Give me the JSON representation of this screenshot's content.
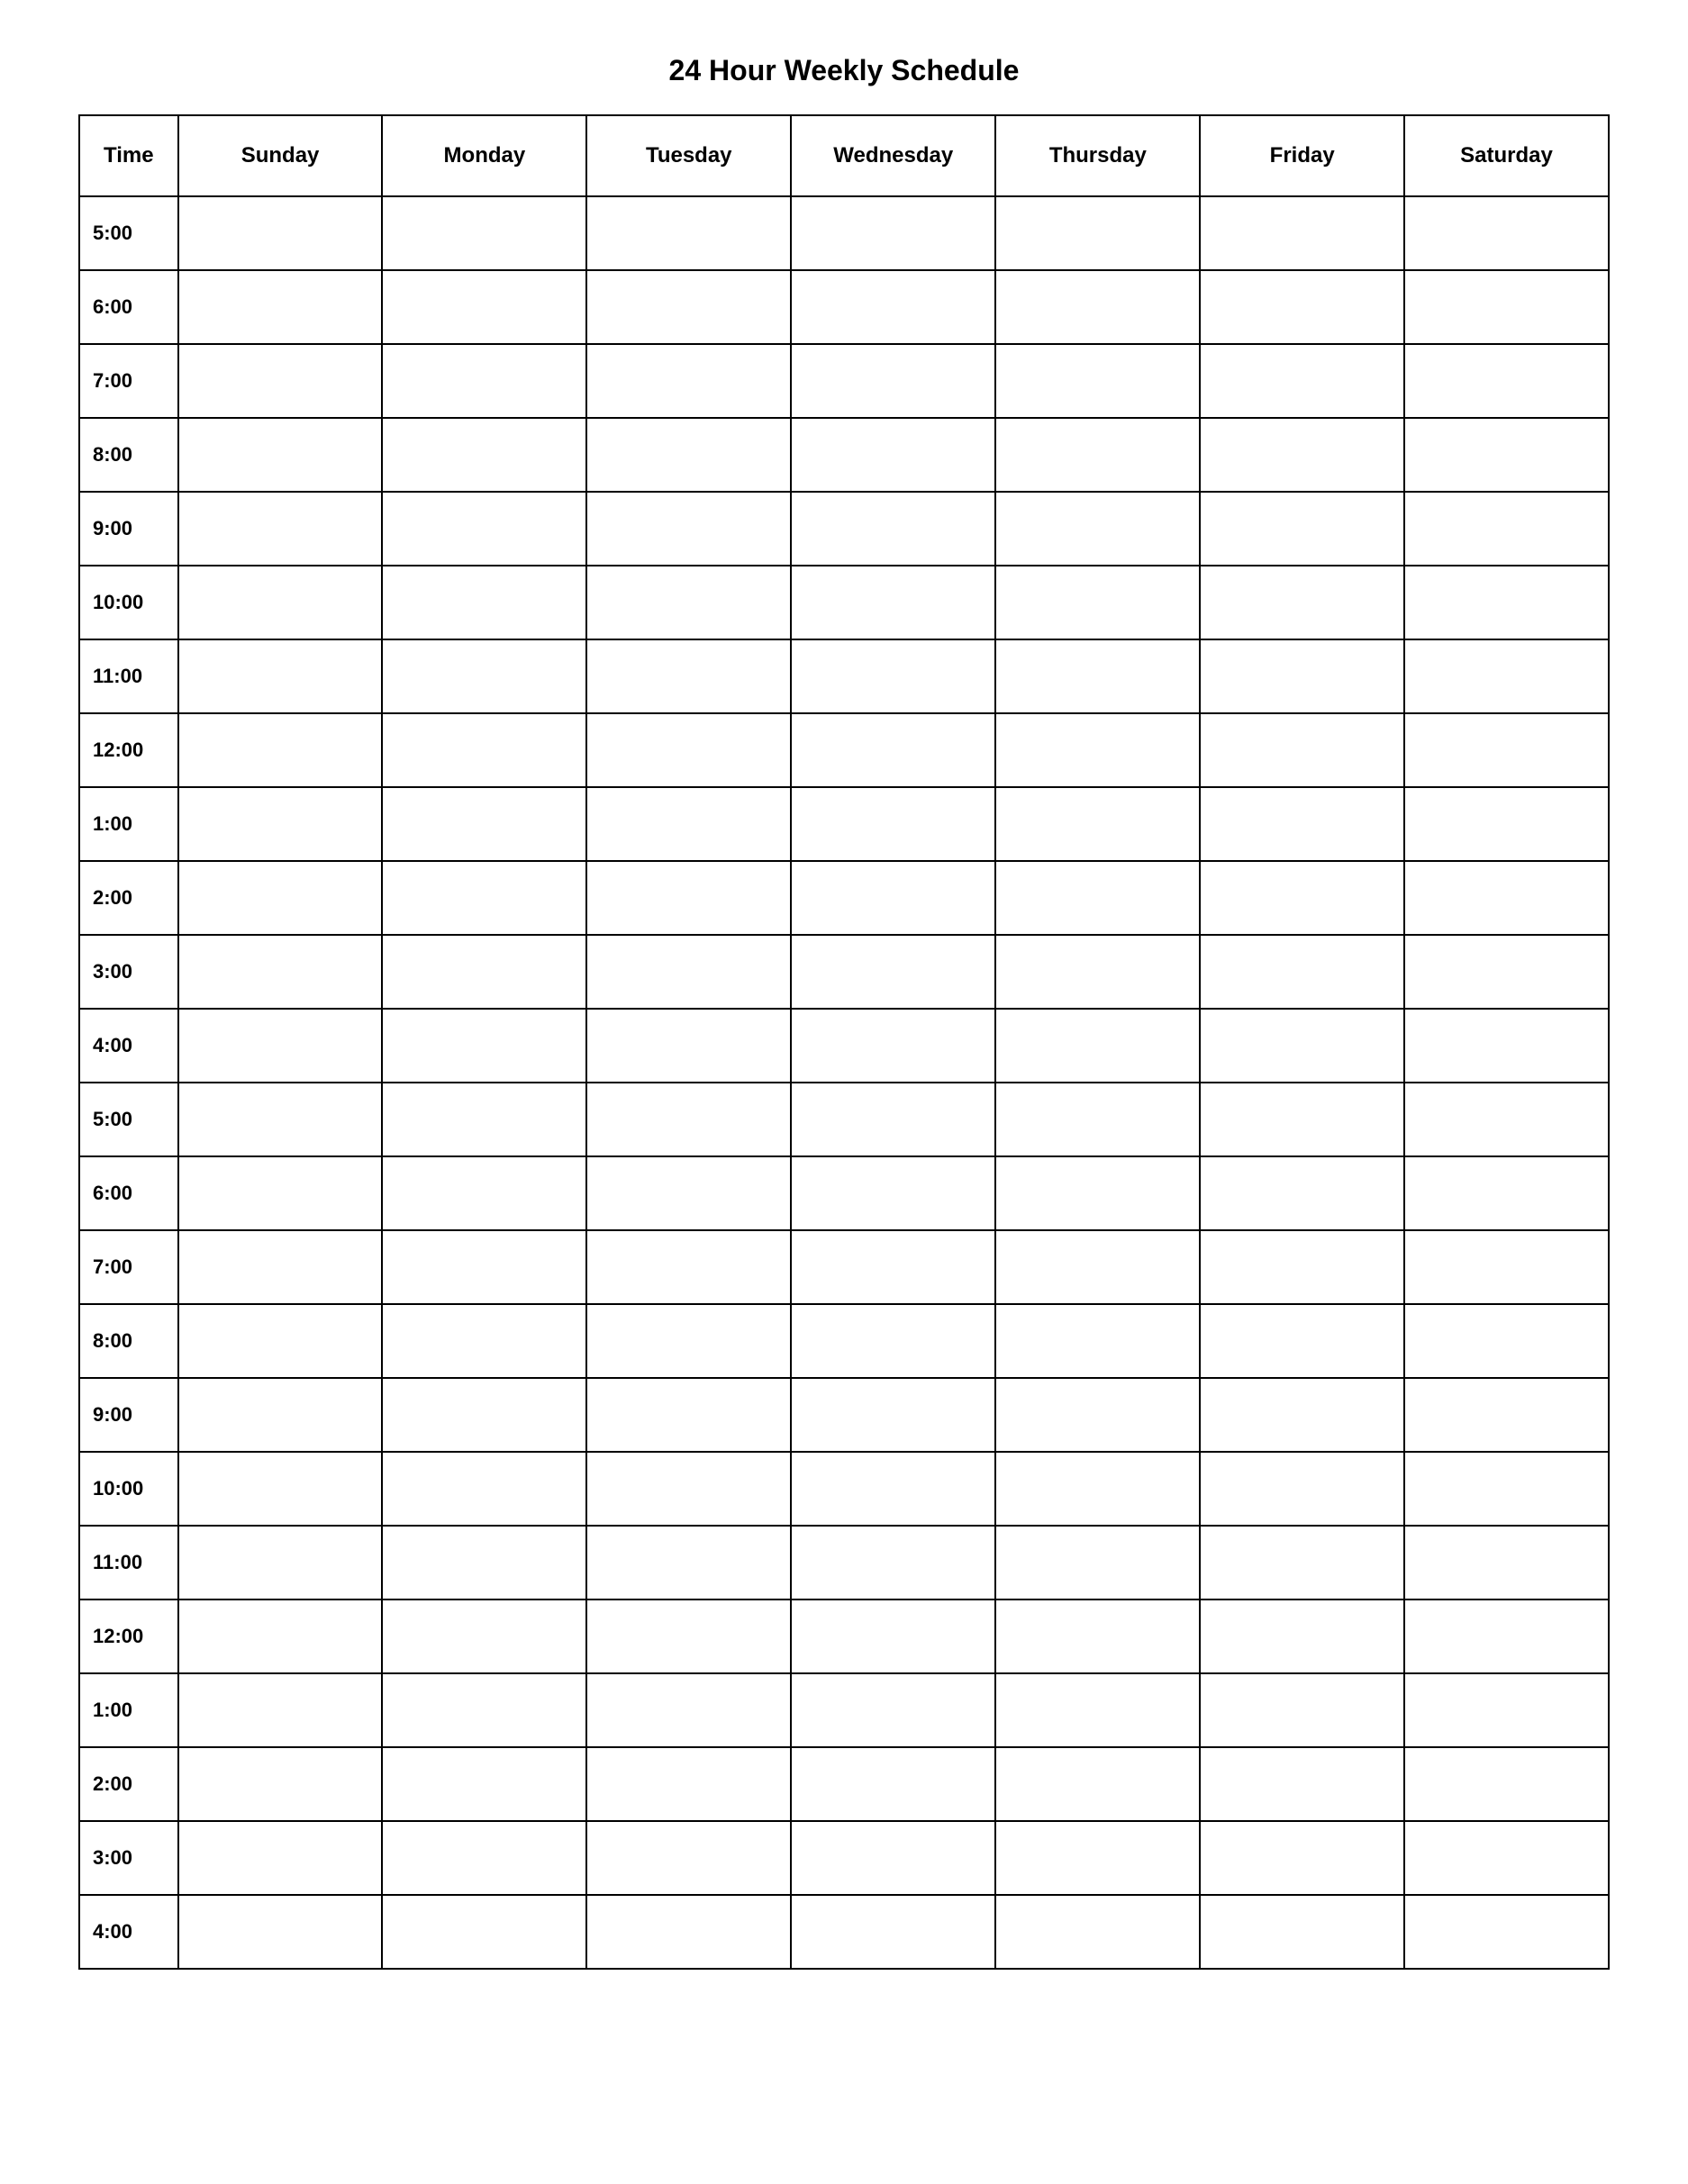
{
  "title": "24 Hour Weekly Schedule",
  "columns": [
    "Time",
    "Sunday",
    "Monday",
    "Tuesday",
    "Wednesday",
    "Thursday",
    "Friday",
    "Saturday"
  ],
  "times": [
    "5:00",
    "6:00",
    "7:00",
    "8:00",
    "9:00",
    "10:00",
    "11:00",
    "12:00",
    "1:00",
    "2:00",
    "3:00",
    "4:00",
    "5:00",
    "6:00",
    "7:00",
    "8:00",
    "9:00",
    "10:00",
    "11:00",
    "12:00",
    "1:00",
    "2:00",
    "3:00",
    "4:00"
  ]
}
